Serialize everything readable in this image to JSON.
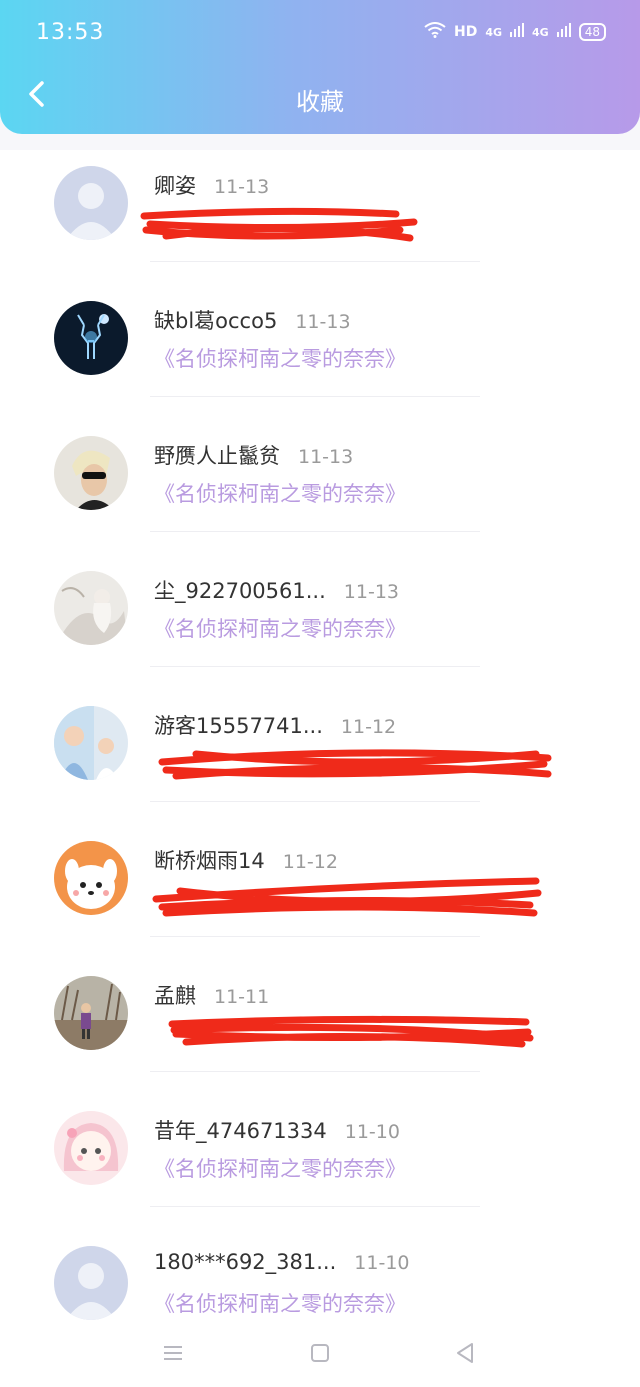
{
  "status_bar": {
    "time": "13:53",
    "hd": "HD",
    "signal1": "4G",
    "signal2": "4G",
    "battery": "48"
  },
  "header": {
    "title": "收藏",
    "back_icon": "chevron-left-icon"
  },
  "items": [
    {
      "name": "卿姿",
      "date": "11-13",
      "work": "",
      "avatar": "default",
      "redacted": true
    },
    {
      "name": "缺bl葛occo5",
      "date": "11-13",
      "work": "《名侦探柯南之零的奈奈》",
      "avatar": "deer",
      "redacted": false
    },
    {
      "name": "野赝人止鬣贫",
      "date": "11-13",
      "work": "《名侦探柯南之零的奈奈》",
      "avatar": "sunglasses",
      "redacted": false
    },
    {
      "name": "尘_922700561...",
      "date": "11-13",
      "work": "《名侦探柯南之零的奈奈》",
      "avatar": "painting",
      "redacted": false
    },
    {
      "name": "游客15557741...",
      "date": "11-12",
      "work": "",
      "avatar": "baby",
      "redacted": true
    },
    {
      "name": "断桥烟雨14",
      "date": "11-12",
      "work": "",
      "avatar": "dog",
      "redacted": true
    },
    {
      "name": "孟麒",
      "date": "11-11",
      "work": "",
      "avatar": "outdoor",
      "redacted": true
    },
    {
      "name": "昔年_474671334",
      "date": "11-10",
      "work": "《名侦探柯南之零的奈奈》",
      "avatar": "anime-girl",
      "redacted": false
    },
    {
      "name": "180***692_381...",
      "date": "11-10",
      "work": "《名侦探柯南之零的奈奈》",
      "avatar": "default",
      "redacted": false
    }
  ],
  "nav": {
    "menu_icon": "menu-icon",
    "home_icon": "square-home-icon",
    "back_icon": "triangle-back-icon"
  },
  "colors": {
    "accent_work": "#b99be0",
    "header_gradient_start": "#5bd6f2",
    "header_gradient_end": "#b79ae9",
    "redaction": "#ef2a1a"
  }
}
